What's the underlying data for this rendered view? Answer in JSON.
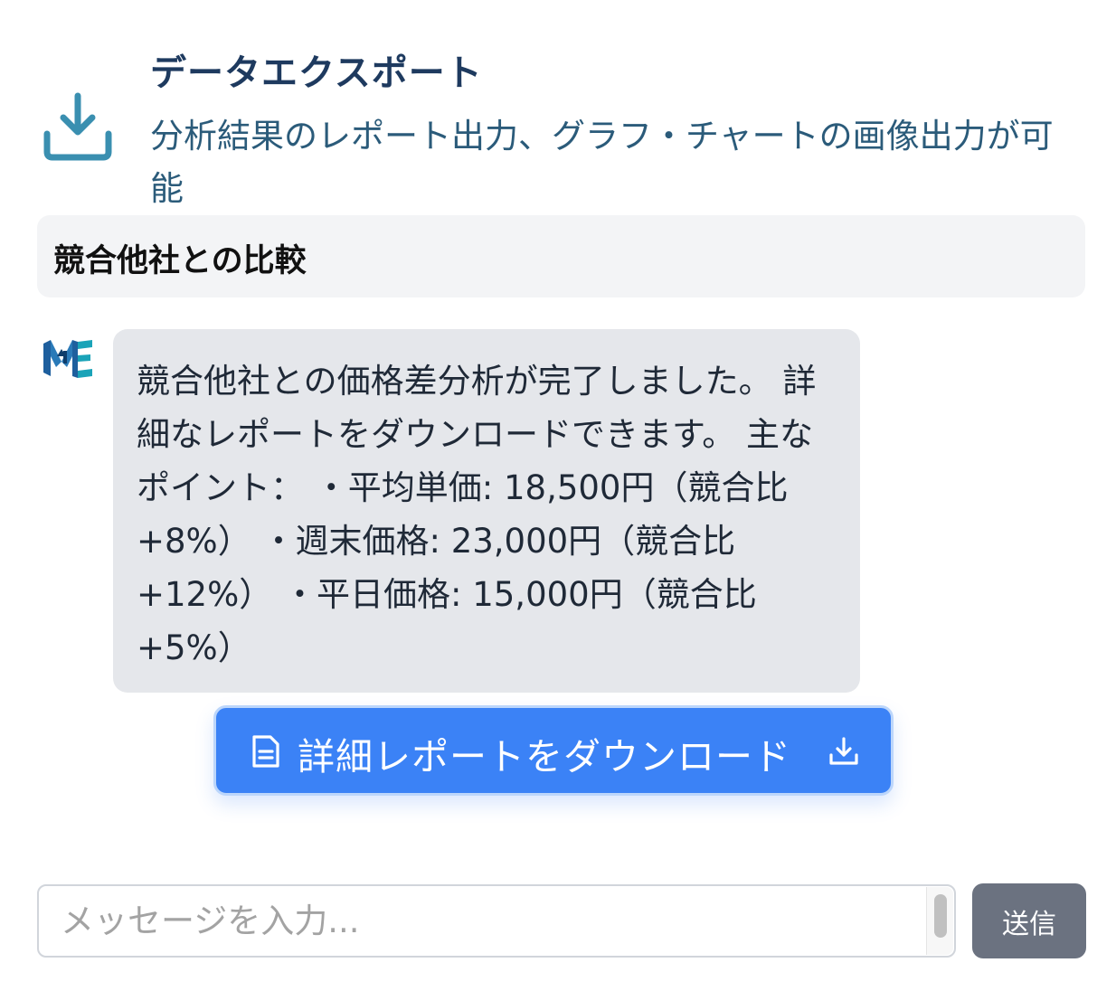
{
  "feature": {
    "title": "データエクスポート",
    "description": "分析結果のレポート出力、グラフ・チャートの画像出力が可能",
    "icon": "download-tray-icon",
    "icon_color": "#3a8fb0"
  },
  "section": {
    "title": "競合他社との比較"
  },
  "chat": {
    "assistant_avatar": "MAE logo",
    "message": "競合他社との価格差分析が完了しました。 詳細なレポートをダウンロードできます。 主なポイント： ・平均単価: 18,500円（競合比+8%） ・週末価格: 23,000円（競合比+12%） ・平日価格: 15,000円（競合比+5%）",
    "download_button": {
      "label": "詳細レポートをダウンロード",
      "leading_icon": "document-icon",
      "trailing_icon": "download-icon",
      "color": "#3b82f6"
    }
  },
  "composer": {
    "placeholder": "メッセージを入力...",
    "value": "",
    "send_label": "送信",
    "send_color": "#6b7280"
  }
}
